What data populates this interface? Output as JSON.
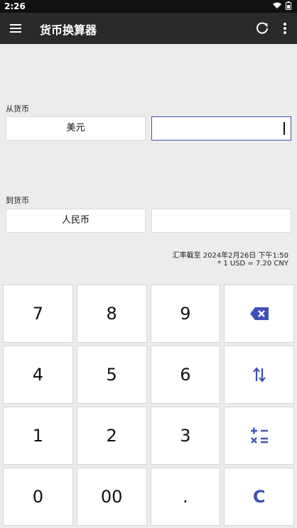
{
  "status_bar": {
    "time": "2:26"
  },
  "toolbar": {
    "title": "货币换算器"
  },
  "from": {
    "label": "从货币",
    "currency": "美元",
    "amount": ""
  },
  "to": {
    "label": "到货币",
    "currency": "人民币",
    "amount": ""
  },
  "rate_info": {
    "date_line": "汇率截至 2024年2月26日 下午1:50",
    "rate_line": "* 1 USD = 7.20 CNY"
  },
  "keypad": {
    "k7": "7",
    "k8": "8",
    "k9": "9",
    "k4": "4",
    "k5": "5",
    "k6": "6",
    "k1": "1",
    "k2": "2",
    "k3": "3",
    "k0": "0",
    "k00": "00",
    "kdot": ".",
    "kclear": "C"
  },
  "colors": {
    "accent": "#3f51b5",
    "toolbar_bg": "#2a2a2a",
    "page_bg": "#ececec"
  },
  "icons": {
    "menu": "menu-icon",
    "refresh": "refresh-icon",
    "more": "more-vert-icon",
    "backspace": "backspace-icon",
    "swap": "swap-vert-icon",
    "operators": "calculator-ops-icon"
  }
}
